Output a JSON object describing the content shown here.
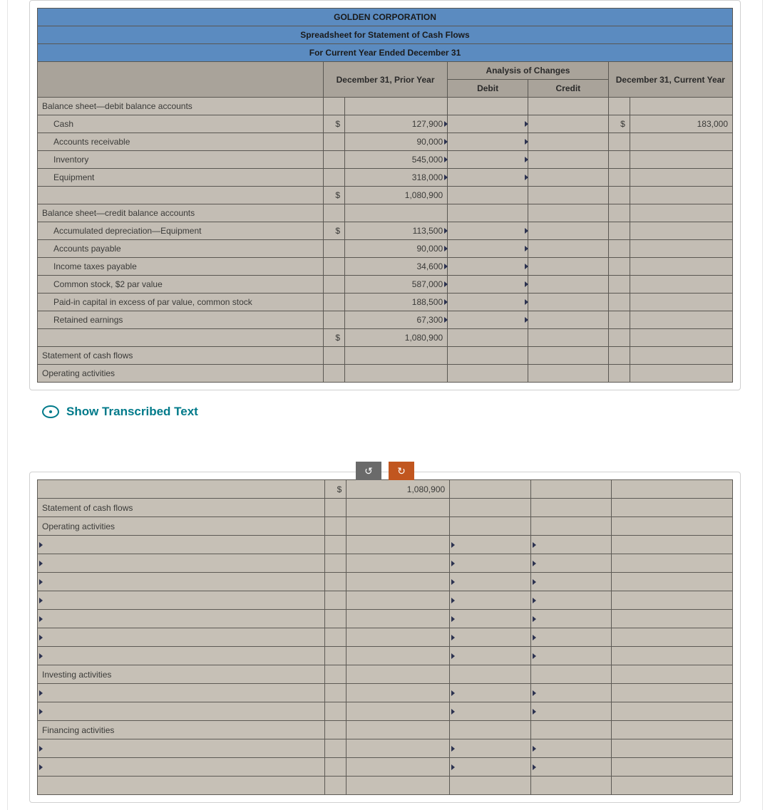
{
  "header": {
    "company": "GOLDEN CORPORATION",
    "title": "Spreadsheet for Statement of Cash Flows",
    "period": "For Current Year Ended December 31"
  },
  "columns": {
    "prior": "December 31, Prior Year",
    "analysis": "Analysis of Changes",
    "debit": "Debit",
    "credit": "Credit",
    "current": "December 31, Current Year"
  },
  "sections": {
    "debit_header": "Balance sheet—debit balance accounts",
    "credit_header": "Balance sheet—credit balance accounts",
    "stmt_cf": "Statement of cash flows",
    "operating": "Operating activities",
    "investing": "Investing activities",
    "financing": "Financing activities"
  },
  "rows": {
    "cash": {
      "label": "Cash",
      "prior_sym": "$",
      "prior": "127,900",
      "cur_sym": "$",
      "cur": "183,000"
    },
    "ar": {
      "label": "Accounts receivable",
      "prior": "90,000"
    },
    "inv": {
      "label": "Inventory",
      "prior": "545,000"
    },
    "equip": {
      "label": "Equipment",
      "prior": "318,000"
    },
    "debit_total": {
      "sym": "$",
      "amount": "1,080,900"
    },
    "accdep": {
      "label": "Accumulated depreciation—Equipment",
      "prior_sym": "$",
      "prior": "113,500"
    },
    "ap": {
      "label": "Accounts payable",
      "prior": "90,000"
    },
    "itp": {
      "label": "Income taxes payable",
      "prior": "34,600"
    },
    "cs": {
      "label": "Common stock, $2 par value",
      "prior": "587,000"
    },
    "pic": {
      "label": "Paid-in capital in excess of par value, common stock",
      "prior": "188,500"
    },
    "re": {
      "label": "Retained earnings",
      "prior": "67,300"
    },
    "credit_total": {
      "sym": "$",
      "amount": "1,080,900"
    }
  },
  "panel2": {
    "top_sym": "$",
    "top_amount": "1,080,900"
  },
  "show_link": "Show Transcribed Text",
  "buttons": {
    "undo": "↺",
    "redo": "↻"
  }
}
